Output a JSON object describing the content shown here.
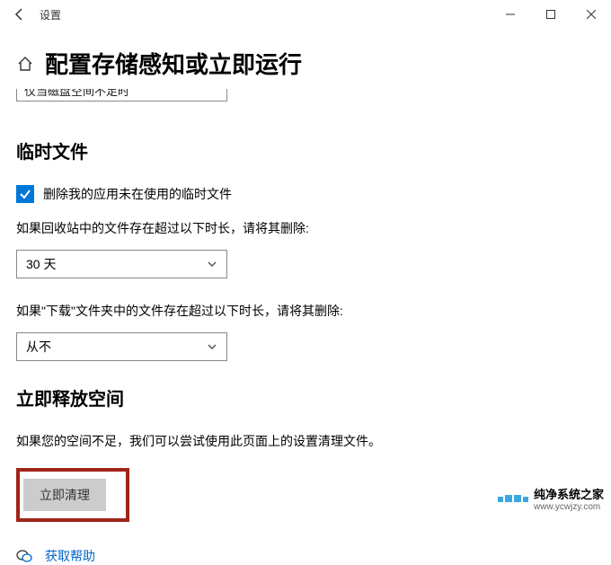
{
  "titlebar": {
    "title": "设置"
  },
  "header": {
    "page_title": "配置存储感知或立即运行"
  },
  "truncated_select": {
    "visible_text": "仅当磁盘空间不足时"
  },
  "temp": {
    "heading": "临时文件",
    "checkbox_label": "删除我的应用未在使用的临时文件",
    "recycle_desc": "如果回收站中的文件存在超过以下时长，请将其删除:",
    "recycle_value": "30 天",
    "downloads_desc": "如果\"下载\"文件夹中的文件存在超过以下时长，请将其删除:",
    "downloads_value": "从不"
  },
  "freeup": {
    "heading": "立即释放空间",
    "desc": "如果您的空间不足，我们可以尝试使用此页面上的设置清理文件。",
    "button": "立即清理"
  },
  "help": {
    "link": "获取帮助"
  },
  "watermark": {
    "main": "纯净系统之家",
    "sub": "www.ycwjzy.com"
  },
  "icons": {
    "back": "back-arrow",
    "minimize": "minimize",
    "maximize": "maximize",
    "close": "close",
    "home": "home",
    "chevron": "chevron-down",
    "help": "help-bubble"
  }
}
